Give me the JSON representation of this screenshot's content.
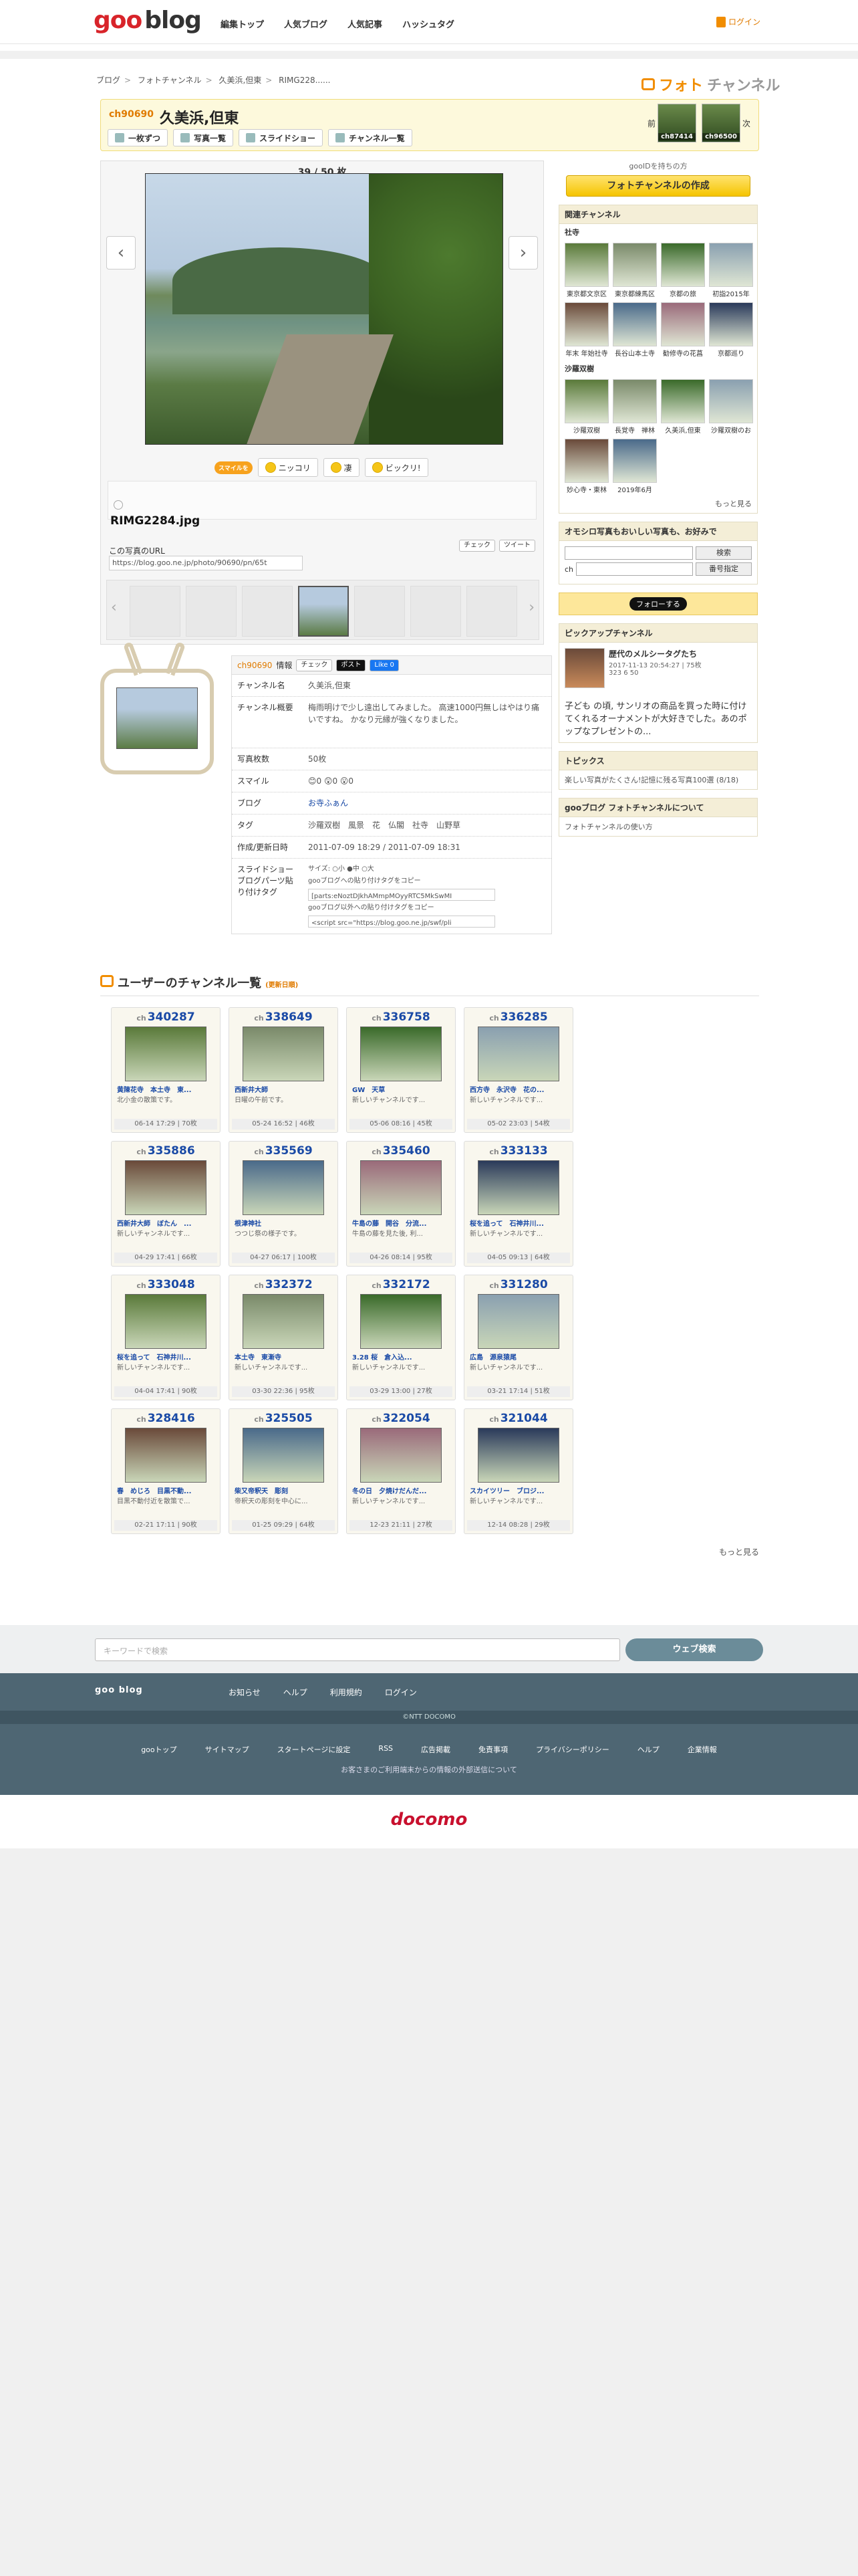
{
  "header": {
    "logo_goo": "goo",
    "logo_blog": "blog",
    "nav": [
      "編集トップ",
      "人気ブログ",
      "人気記事",
      "ハッシュタグ"
    ],
    "login": "ログイン"
  },
  "breadcrumb": [
    "ブログ",
    "フォトチャンネル",
    "久美浜,但東",
    "RIMG228......"
  ],
  "brand": {
    "prefix": "フォト",
    "suffix": "チャンネル"
  },
  "channel": {
    "no": "ch90690",
    "title": "久美浜,但東",
    "buttons": [
      "一枚ずつ",
      "写真一覧",
      "スライドショー",
      "チャンネル一覧"
    ],
    "prev_label": "前",
    "next_label": "次",
    "prev_ch": "ch87414",
    "next_ch": "ch96500"
  },
  "viewer": {
    "counter": "39 / 50 枚",
    "reaction_tag": "スマイルを",
    "reactions": [
      "ニッコリ",
      "凄",
      "ビックリ!"
    ],
    "filename": "RIMG2284.jpg",
    "url_label": "この写真のURL",
    "url": "https://blog.goo.ne.jp/photo/90690/pn/65t",
    "share": [
      "チェック",
      "ツイート"
    ]
  },
  "info": {
    "header_no": "ch90690",
    "header_label": "情報",
    "share": [
      "チェック",
      "ポスト",
      "Like 0"
    ],
    "rows": [
      {
        "k": "チャンネル名",
        "v": "久美浜,但東"
      },
      {
        "k": "チャンネル概要",
        "v": "梅雨明けで少し遠出してみました。 高速1000円無しはやはり痛いですね。 かなり元縁が強くなりました。"
      },
      {
        "k": "写真枚数",
        "v": "50枚"
      },
      {
        "k": "スマイル",
        "v": "😊0 😲0 😮0"
      },
      {
        "k": "ブログ",
        "v": "お寺ふぁん"
      },
      {
        "k": "タグ",
        "v": "沙羅双樹　風景　花　仏閣　社寺　山野草"
      },
      {
        "k": "作成/更新日時",
        "v": "2011-07-09 18:29 / 2011-07-09 18:31"
      }
    ],
    "parts_label": "スライドショーブログパーツ貼り付けタグ",
    "size_label": "サイズ:",
    "sizes": [
      "小",
      "中",
      "大"
    ],
    "parts_inner": "gooブログへの貼り付けタグをコピー",
    "parts_code": "[parts:eNoztDJkhAMmpMOyyRTC5MkSwMI",
    "parts_outer": "gooブログ以外への貼り付けタグをコピー",
    "parts_code2": "<script src=\"https://blog.goo.ne.jp/swf/pli"
  },
  "side": {
    "count_text": "gooIDを持ちの方",
    "create": "フォトチャンネルの作成",
    "related_title": "関連チャンネル",
    "sub1": "社寺",
    "sub1_items": [
      "東京都文京区",
      "東京都練馬区",
      "京都の旅",
      "初詣2015年",
      "年末 年始社寺",
      "長谷山本土寺",
      "勧修寺の花菖",
      "京都巡り"
    ],
    "sub2": "沙羅双樹",
    "sub2_items": [
      "沙羅双樹",
      "長覚寺　禅林",
      "久美浜,但東",
      "沙羅双樹のお",
      "妙心寺・東林",
      "2019年6月"
    ],
    "more": "もっと見る",
    "search_title": "オモシロ写真もおいしい写真も、お好みで",
    "search_btn": "検索",
    "ch_label": "ch",
    "number_btn": "番号指定",
    "follow": "フォローする",
    "pickup_title": "ピックアップチャンネル",
    "pickup_name": "歴代のメルシータグたち",
    "pickup_date": "2017-11-13 20:54:27 | 75枚",
    "pickup_counts": "323 6 50",
    "pickup_desc": "子ども の頃, サンリオの商品を買った時に付けてくれるオーナメントが大好きでした。あのポップなプレゼントの...",
    "topics_title": "トピックス",
    "topics_item": "楽しい写真がたくさん!記憶に残る写真100選",
    "topics_date": "(8/18)",
    "about_title": "gooブログ フォトチャンネルについて",
    "about_item": "フォトチャンネルの使い方"
  },
  "user_channels": {
    "title": "ユーザーのチャンネル一覧",
    "sub": "(更新日順)",
    "more": "もっと見る",
    "cards": [
      {
        "no": "340287",
        "title": "黄陳花寺　本土寺　東...",
        "desc": "北小金の散策です。",
        "foot": "06-14 17:29 | 70枚"
      },
      {
        "no": "338649",
        "title": "西新井大師",
        "desc": "日曜の午前です。",
        "foot": "05-24 16:52 | 46枚"
      },
      {
        "no": "336758",
        "title": "GW　天草",
        "desc": "新しいチャンネルです...",
        "foot": "05-06 08:16 | 45枚"
      },
      {
        "no": "336285",
        "title": "西方寺　永沢寺　花の...",
        "desc": "新しいチャンネルです...",
        "foot": "05-02 23:03 | 54枚"
      },
      {
        "no": "335886",
        "title": "西新井大師　ぼたん　...",
        "desc": "新しいチャンネルです...",
        "foot": "04-29 17:41 | 66枚"
      },
      {
        "no": "335569",
        "title": "根津神社",
        "desc": "つつじ祭の様子です。",
        "foot": "04-27 06:17 | 100枚"
      },
      {
        "no": "335460",
        "title": "牛島の藤　開谷　分流...",
        "desc": "牛島の藤を見た後, 利...",
        "foot": "04-26 08:14 | 95枚"
      },
      {
        "no": "333133",
        "title": "桜を追って　石神井川...",
        "desc": "新しいチャンネルです...",
        "foot": "04-05 09:13 | 64枚"
      },
      {
        "no": "333048",
        "title": "桜を追って　石神井川...",
        "desc": "新しいチャンネルです...",
        "foot": "04-04 17:41 | 90枚"
      },
      {
        "no": "332372",
        "title": "本土寺　東漸寺",
        "desc": "新しいチャンネルです...",
        "foot": "03-30 22:36 | 95枚"
      },
      {
        "no": "332172",
        "title": "3.28 桜　倉入込...",
        "desc": "新しいチャンネルです...",
        "foot": "03-29 13:00 | 27枚"
      },
      {
        "no": "331280",
        "title": "広島　源泉猿尾",
        "desc": "新しいチャンネルです...",
        "foot": "03-21 17:14 | 51枚"
      },
      {
        "no": "328416",
        "title": "春　めじろ　目黒不動...",
        "desc": "目黒不動付近を散策で...",
        "foot": "02-21 17:11 | 90枚"
      },
      {
        "no": "325505",
        "title": "柴又帝釈天　彫刻",
        "desc": "帝釈天の彫刻を中心に...",
        "foot": "01-25 09:29 | 64枚"
      },
      {
        "no": "322054",
        "title": "冬の日　夕焼けだんだ...",
        "desc": "新しいチャンネルです...",
        "foot": "12-23 21:11 | 27枚"
      },
      {
        "no": "321044",
        "title": "スカイツリー　ブロジ...",
        "desc": "新しいチャンネルです...",
        "foot": "12-14 08:28 | 29枚"
      }
    ]
  },
  "search_bar": {
    "placeholder": "キーワードで検索",
    "button": "ウェブ検索"
  },
  "footer": {
    "brand": "goo blog",
    "links1": [
      "お知らせ",
      "ヘルプ",
      "利用規約",
      "ログイン"
    ],
    "copyright": "©NTT DOCOMO",
    "links2": [
      "gooトップ",
      "サイトマップ",
      "スタートページに設定",
      "RSS",
      "広告掲載",
      "免責事項",
      "プライバシーポリシー",
      "ヘルプ",
      "企業情報"
    ],
    "note": "お客さまのご利用端末からの情報の外部送信について",
    "docomo": "docomo"
  }
}
